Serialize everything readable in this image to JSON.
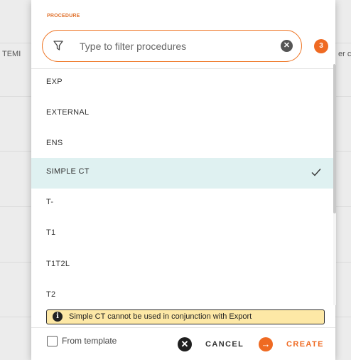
{
  "background": {
    "left_column_text": "TEMI",
    "right_column_text": "er c"
  },
  "dialog": {
    "field_label": "PROCEDURE",
    "filter": {
      "placeholder": "Type to filter procedures",
      "value": "",
      "icon": "filter-icon",
      "clear_icon": "clear-icon"
    },
    "count_badge": "3",
    "items": [
      {
        "label": "EXP",
        "selected": false
      },
      {
        "label": "EXTERNAL",
        "selected": false
      },
      {
        "label": "ENS",
        "selected": false
      },
      {
        "label": "SIMPLE CT",
        "selected": true
      },
      {
        "label": "T-",
        "selected": false
      },
      {
        "label": "T1",
        "selected": false
      },
      {
        "label": "T1T2L",
        "selected": false
      },
      {
        "label": "T2",
        "selected": false
      }
    ],
    "warning": {
      "icon": "info-icon",
      "text": "Simple CT cannot be used in conjunction with Export"
    },
    "footer": {
      "from_template_label": "From template",
      "from_template_checked": false,
      "cancel_label": "CANCEL",
      "create_label": "CREATE"
    },
    "colors": {
      "accent": "#ef6a22",
      "selected_row": "#dff1f1",
      "warning_bg": "#fde8a6"
    }
  }
}
